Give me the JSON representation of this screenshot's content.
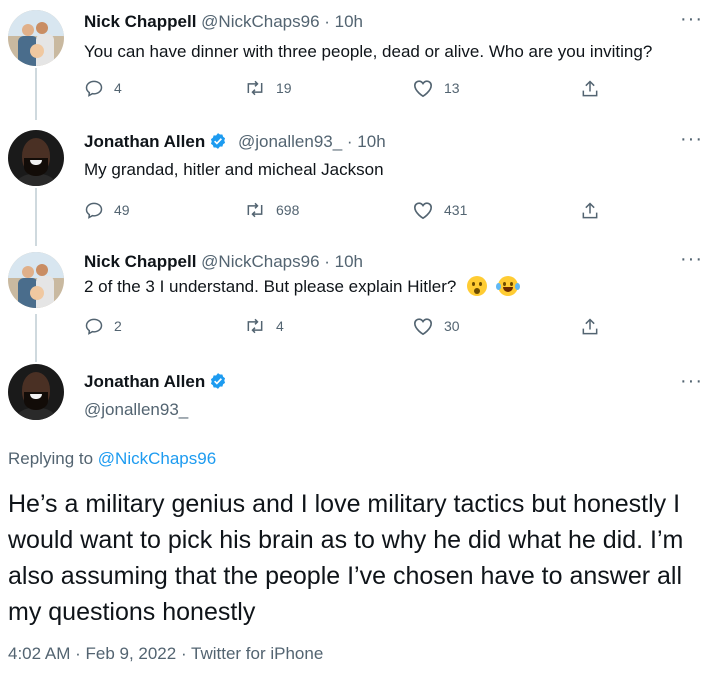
{
  "tweets": [
    {
      "name": "Nick Chappell",
      "handle": "@NickChaps96",
      "time": "· 10h",
      "text": "You can have dinner with three people, dead or alive. Who are you inviting?",
      "replies": "4",
      "retweets": "19",
      "likes": "13"
    },
    {
      "name": "Jonathan Allen",
      "handle": "@jonallen93_",
      "time": "· 10h",
      "text": "My grandad, hitler and micheal Jackson",
      "replies": "49",
      "retweets": "698",
      "likes": "431"
    },
    {
      "name": "Nick Chappell",
      "handle": "@NickChaps96",
      "time": "· 10h",
      "text": "2 of the 3 I understand. But please explain Hitler?",
      "replies": "2",
      "retweets": "4",
      "likes": "30"
    }
  ],
  "main_tweet": {
    "name": "Jonathan Allen",
    "handle": "@jonallen93_",
    "replying_prefix": "Replying to",
    "replying_to": "@NickChaps96",
    "text": "He’s a military genius and I love military tactics but honestly I would want to pick his brain as to why he did what he did. I’m also assuming that the people I’ve chosen have to answer all my questions honestly",
    "timestamp": "4:02 AM · Feb 9, 2022 · Twitter for iPhone"
  },
  "more_label": "···",
  "emojis": [
    "astonished-face-emoji",
    "face-with-tears-of-joy-emoji"
  ],
  "icons": [
    "reply-icon",
    "retweet-icon",
    "like-icon",
    "share-icon",
    "verified-badge-icon",
    "more-options-icon"
  ],
  "colors": {
    "text": "#0f1419",
    "secondary": "#536471",
    "link": "#1d9bf0",
    "verified": "#1d9bf0",
    "thread": "#cfd9de"
  }
}
